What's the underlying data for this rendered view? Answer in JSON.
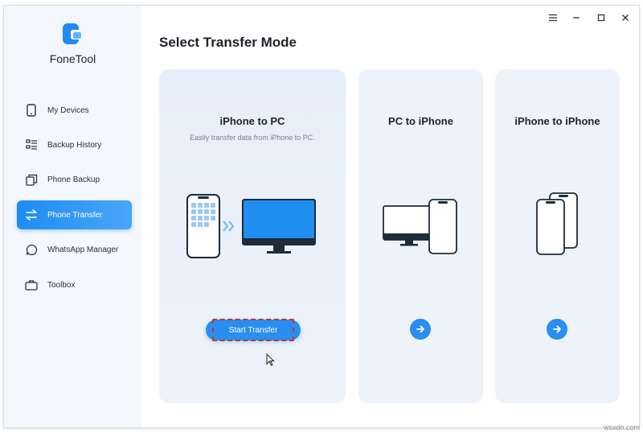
{
  "app": {
    "name": "FoneTool"
  },
  "sidebar": {
    "items": [
      {
        "label": "My Devices",
        "icon": "phone-icon"
      },
      {
        "label": "Backup History",
        "icon": "list-icon"
      },
      {
        "label": "Phone Backup",
        "icon": "copy-icon"
      },
      {
        "label": "Phone Transfer",
        "icon": "transfer-icon",
        "active": true
      },
      {
        "label": "WhatsApp Manager",
        "icon": "chat-bubble-icon"
      },
      {
        "label": "Toolbox",
        "icon": "briefcase-icon"
      }
    ]
  },
  "titlebar": {
    "icons": [
      "menu-icon",
      "minimize-icon",
      "maximize-icon",
      "close-icon"
    ]
  },
  "main": {
    "title": "Select Transfer Mode",
    "cards": [
      {
        "title": "iPhone to PC",
        "description": "Easily transfer data from iPhone to PC.",
        "button_label": "Start Transfer",
        "selected": true
      },
      {
        "title": "PC to iPhone"
      },
      {
        "title": "iPhone to iPhone"
      }
    ]
  },
  "watermark": "wsxdn.com",
  "colors": {
    "accent": "#2a8ef0",
    "sidebar_bg": "#f4f7fb",
    "card_bg": "#eef3fa",
    "highlight": "#c0392b"
  }
}
